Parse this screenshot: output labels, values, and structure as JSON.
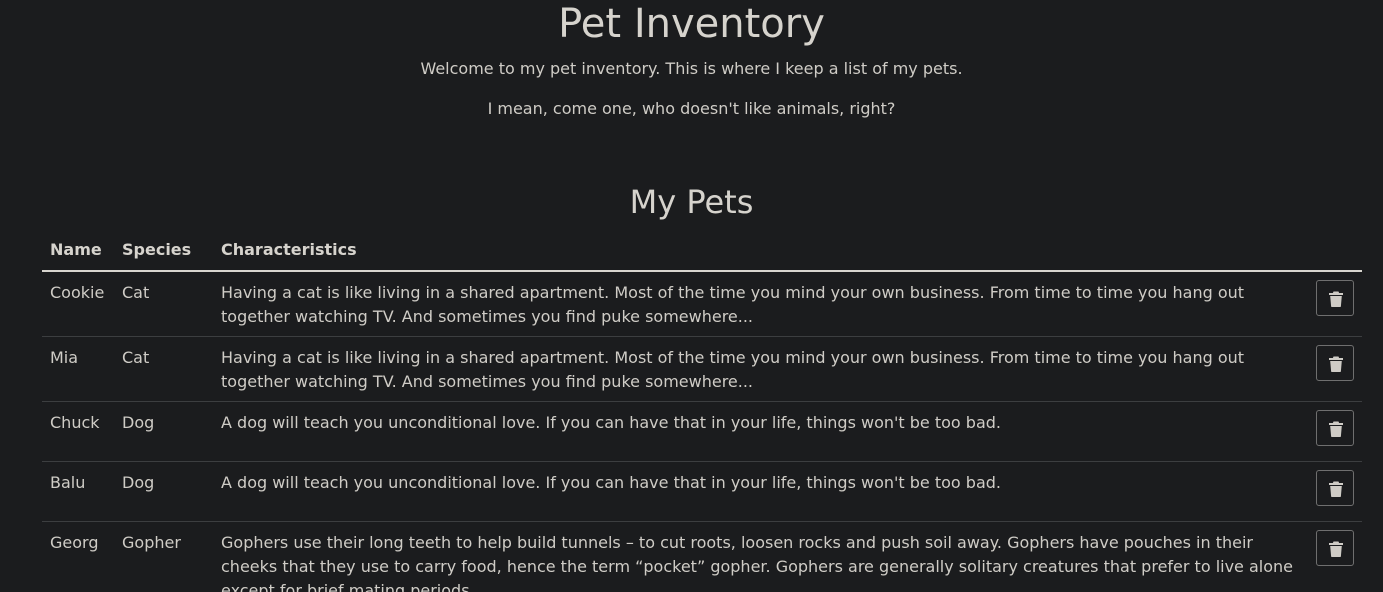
{
  "header": {
    "title": "Pet Inventory",
    "intro_1": "Welcome to my pet inventory. This is where I keep a list of my pets.",
    "intro_2": "I mean, come one, who doesn't like animals, right?"
  },
  "section": {
    "title": "My Pets"
  },
  "table": {
    "columns": [
      "Name",
      "Species",
      "Characteristics"
    ],
    "rows": [
      {
        "name": "Cookie",
        "species": "Cat",
        "characteristics": "Having a cat is like living in a shared apartment. Most of the time you mind your own business. From time to time you hang out together watching TV. And sometimes you find puke somewhere..."
      },
      {
        "name": "Mia",
        "species": "Cat",
        "characteristics": "Having a cat is like living in a shared apartment. Most of the time you mind your own business. From time to time you hang out together watching TV. And sometimes you find puke somewhere..."
      },
      {
        "name": "Chuck",
        "species": "Dog",
        "characteristics": "A dog will teach you unconditional love. If you can have that in your life, things won't be too bad."
      },
      {
        "name": "Balu",
        "species": "Dog",
        "characteristics": "A dog will teach you unconditional love. If you can have that in your life, things won't be too bad."
      },
      {
        "name": "Georg",
        "species": "Gopher",
        "characteristics": "Gophers use their long teeth to help build tunnels – to cut roots, loosen rocks and push soil away. Gophers have pouches in their cheeks that they use to carry food, hence the term “pocket” gopher. Gophers are generally solitary creatures that prefer to live alone except for brief mating periods."
      }
    ],
    "row_action_icon": "trash-icon"
  },
  "colors": {
    "background": "#1b1c1e",
    "text": "#cfccc6",
    "header_rule": "#d8d5cf",
    "row_rule": "#3c3e40",
    "button_border": "#6f6f6f"
  }
}
